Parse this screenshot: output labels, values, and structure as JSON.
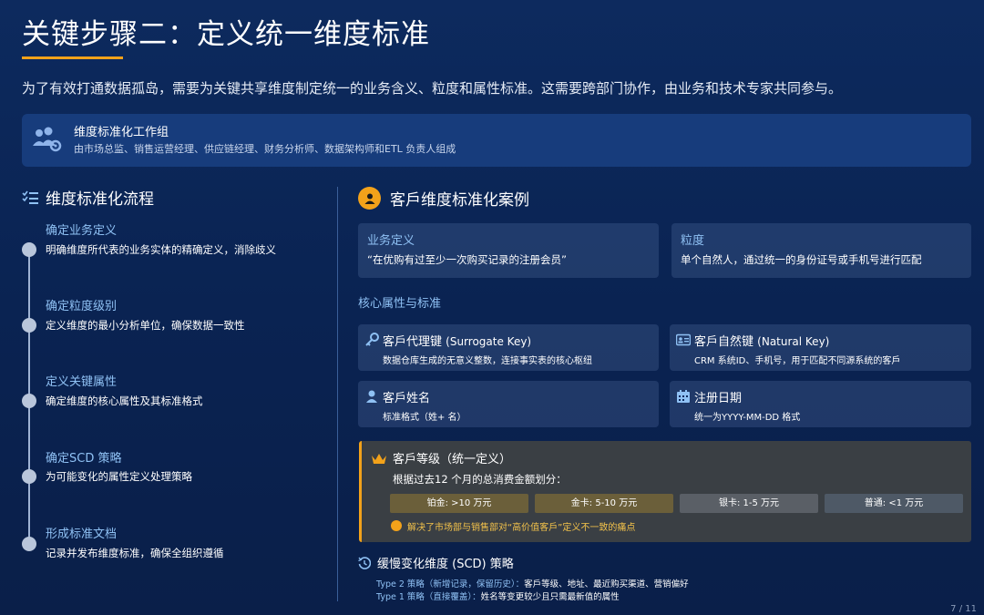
{
  "title": "关键步骤二：定义统一维度标准",
  "intro": "为了有效打通数据孤岛，需要为关键共享维度制定统一的业务含义、粒度和属性标准。这需要跨部门协作，由业务和技术专家共同参与。",
  "workgroup": {
    "icon": "users-gear-icon",
    "title": "维度标准化工作组",
    "desc": "由市场总监、销售运营经理、供应链经理、财务分析师、数据架构师和ETL 负责人组成"
  },
  "flow": {
    "icon": "list-check-icon",
    "title": "维度标准化流程",
    "steps": [
      {
        "title": "确定业务定义",
        "desc": "明确维度所代表的业务实体的精确定义，消除歧义"
      },
      {
        "title": "确定粒度级别",
        "desc": "定义维度的最小分析单位，确保数据一致性"
      },
      {
        "title": "定义关键属性",
        "desc": "确定维度的核心属性及其标准格式"
      },
      {
        "title": "确定SCD 策略",
        "desc": "为可能变化的属性定义处理策略"
      },
      {
        "title": "形成标准文档",
        "desc": "记录并发布维度标准，确保全组织遵循"
      }
    ]
  },
  "case": {
    "icon": "user-circle-icon",
    "title": "客戶维度标准化案例",
    "business_def": {
      "label": "业务定义",
      "text": "“在优购有过至少一次购买记录的注册会员”"
    },
    "grain": {
      "label": "粒度",
      "text": "单个自然人，通过统一的身份证号或手机号进行匹配"
    },
    "core_label": "核心属性与标准",
    "attrs": [
      {
        "icon": "key-icon",
        "title": "客戶代理键",
        "title_en": "(Surrogate Key)",
        "desc": "数据仓库生成的无意义整数，连接事实表的核心枢纽"
      },
      {
        "icon": "id-card-icon",
        "title": "客戶自然键",
        "title_en": "(Natural Key)",
        "desc": "CRM 系统ID、手机号，用于匹配不同源系统的客戶"
      },
      {
        "icon": "user-icon",
        "title": "客戶姓名",
        "title_en": "",
        "desc": "标准格式（姓+ 名）"
      },
      {
        "icon": "calendar-icon",
        "title": "注册日期",
        "title_en": "",
        "desc": "统一为YYYY-MM-DD  格式"
      }
    ],
    "level": {
      "icon": "crown-icon",
      "title": "客戶等级（统一定义）",
      "sub": "根据过去12 个月的总消费金额划分：",
      "tiers": [
        {
          "label": "铂金: >10  万元",
          "color": "#6b5f3a"
        },
        {
          "label": "金卡: 5-10  万元",
          "color": "#6b5f3a"
        },
        {
          "label": "银卡: 1-5  万元",
          "color": "#5a5f66"
        },
        {
          "label": "普通: <1  万元",
          "color": "#4e5966"
        }
      ],
      "note": "解决了市场部与销售部对“高价值客戶”定义不一致的痛点"
    },
    "scd": {
      "icon": "history-icon",
      "title": "缓慢变化维度 (SCD)    策略",
      "lines": [
        {
          "key": "Type 2   策略（新增记录，保留历史）：",
          "val": "客戶等级、地址、最近购买渠道、营销偏好"
        },
        {
          "key": "Type 1   策略（直接覆盖）：",
          "val": "姓名等变更较少且只需最新值的属性"
        }
      ]
    }
  },
  "page": "7 / 11"
}
